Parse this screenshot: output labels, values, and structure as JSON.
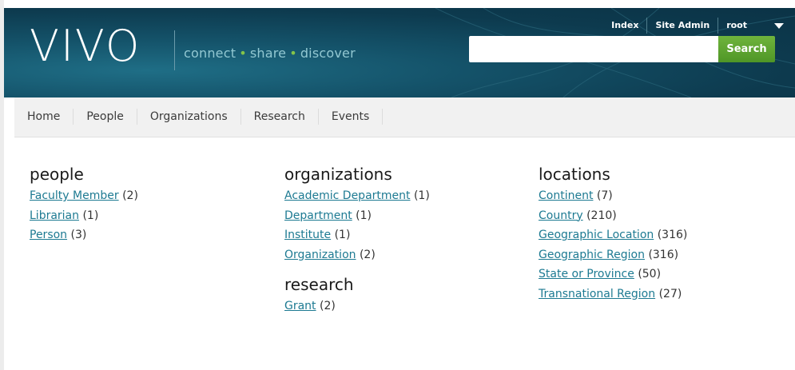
{
  "header": {
    "logo": "VIVO",
    "tagline": [
      "connect",
      "share",
      "discover"
    ],
    "user_nav": [
      "Index",
      "Site Admin",
      "root"
    ],
    "search_button": "Search",
    "search_value": ""
  },
  "nav": [
    "Home",
    "People",
    "Organizations",
    "Research",
    "Events"
  ],
  "columns": [
    {
      "sections": [
        {
          "title": "people",
          "items": [
            {
              "label": "Faculty Member",
              "count": "(2)"
            },
            {
              "label": "Librarian",
              "count": "(1)"
            },
            {
              "label": "Person",
              "count": "(3)"
            }
          ]
        }
      ]
    },
    {
      "sections": [
        {
          "title": "organizations",
          "items": [
            {
              "label": "Academic Department",
              "count": "(1)"
            },
            {
              "label": "Department",
              "count": "(1)"
            },
            {
              "label": "Institute",
              "count": "(1)"
            },
            {
              "label": "Organization",
              "count": "(2)"
            }
          ]
        },
        {
          "title": "research",
          "items": [
            {
              "label": "Grant",
              "count": "(2)"
            }
          ]
        }
      ]
    },
    {
      "sections": [
        {
          "title": "locations",
          "items": [
            {
              "label": "Continent",
              "count": "(7)"
            },
            {
              "label": "Country",
              "count": "(210)"
            },
            {
              "label": "Geographic Location",
              "count": "(316)"
            },
            {
              "label": "Geographic Region",
              "count": "(316)"
            },
            {
              "label": "State or Province",
              "count": "(50)"
            },
            {
              "label": "Transnational Region",
              "count": "(27)"
            }
          ]
        }
      ]
    }
  ],
  "colors": {
    "header_bg": "#0d3a4e",
    "accent_green": "#5aa32f",
    "link": "#1d7a92"
  },
  "icons": {
    "menu_caret": "caret-down-icon"
  }
}
